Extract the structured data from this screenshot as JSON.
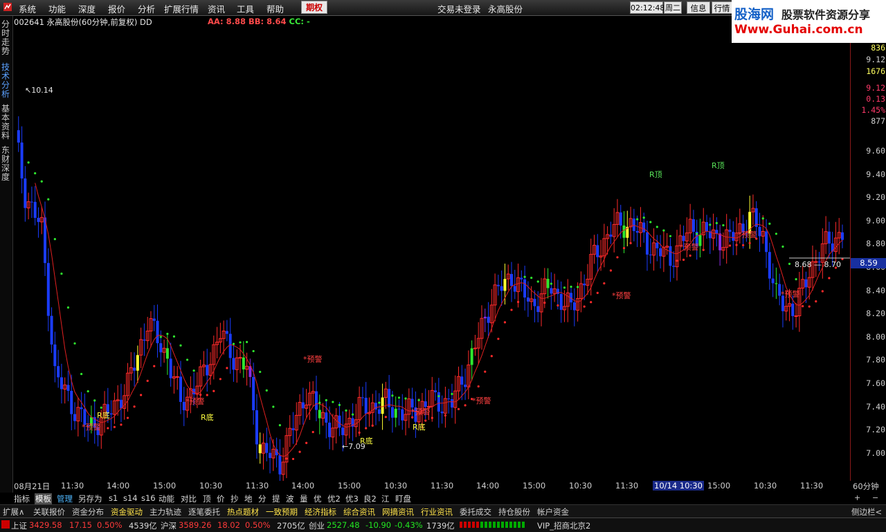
{
  "menu": {
    "items": [
      "系统",
      "功能",
      "深度",
      "报价",
      "分析",
      "扩展行情",
      "资讯",
      "工具",
      "帮助"
    ],
    "active_tab": "期权",
    "trade_status": "交易未登录",
    "stock_name_red": "永高股份",
    "clock": "02:12:48",
    "weekday": "周二",
    "btn_info": "信息",
    "btn_quote": "行情"
  },
  "logo": {
    "line1a": "股海网",
    "line1b": "股票软件资源分享",
    "line2": "Www.Guhai.com.cn"
  },
  "left_tabs": [
    "分时走势",
    "技术分析",
    "基本资料",
    "东财深度"
  ],
  "header": {
    "code_title": "002641 永高股份(60分钟,前复权) DD",
    "aa_label": "AA: 8.88",
    "bb_label": "BB: 8.64",
    "cc_label": "CC: -"
  },
  "right_axis": {
    "top_values": [
      "836",
      "9.12",
      "1676",
      "9.12",
      "0.13",
      "1.45%",
      "877"
    ],
    "price_ticks": [
      "9.60",
      "9.40",
      "9.20",
      "9.00",
      "8.80",
      "8.60",
      "8.40",
      "8.20",
      "8.00",
      "7.80",
      "7.60",
      "7.40",
      "7.20",
      "7.00"
    ],
    "current_price": "8.59",
    "period": "60分钟"
  },
  "time_axis": {
    "labels": [
      "08月21日",
      "11:30",
      "14:00",
      "15:00",
      "10:30",
      "11:30",
      "14:00",
      "15:00",
      "10:30",
      "11:30",
      "14:00",
      "15:00",
      "10:30",
      "11:30",
      "15:00",
      "10:30",
      "11:30"
    ],
    "highlight": "10/14 10:30"
  },
  "annotations": {
    "high_label": "10.14",
    "low_label": "7.09",
    "range_label": "8.68 — 8.70",
    "top_signal": "R顶",
    "bottom_signal": "R底",
    "warn_signal": "预警"
  },
  "toolbar_row": {
    "items": [
      "指标",
      "模板",
      "管理",
      "另存为",
      "s1",
      "s14",
      "s16",
      "动能",
      "对比",
      "顶",
      "价",
      "抄",
      "地",
      "分",
      "提",
      "波",
      "量",
      "优",
      "优2",
      "优3",
      "良2",
      "江",
      "盯盘"
    ],
    "selected": "模板",
    "highlighted": "管理",
    "right_plus": "+",
    "right_minus": "−"
  },
  "feature_row": {
    "items": [
      "扩展∧",
      "关联报价",
      "资金分布",
      "资金驱动",
      "主力轨迹",
      "逐笔委托",
      "热点题材",
      "一致预期",
      "经济指标",
      "综合资讯",
      "网摘资讯",
      "行业资讯",
      "委托成交",
      "持仓股份",
      "帐户资金"
    ],
    "yellow": [
      "资金驱动",
      "热点题材",
      "一致预期",
      "经济指标",
      "综合资讯",
      "网摘资讯",
      "行业资讯"
    ],
    "side": "侧边栏<"
  },
  "status": {
    "sh_name": "上证",
    "sh_price": "3429.58",
    "sh_chg": "17.15",
    "sh_pct": "0.50%",
    "sh_amt": "4539亿",
    "hs_name": "沪深",
    "hs_price": "3589.26",
    "hs_chg": "18.02",
    "hs_pct": "0.50%",
    "hs_amt": "2705亿",
    "cy_name": "创业",
    "cy_price": "2527.48",
    "cy_chg": "-10.90",
    "cy_pct": "-0.43%",
    "cy_amt": "1739亿",
    "server": "VIP_招商北京2"
  },
  "colors": {
    "up": "#ff2a2a",
    "down": "#1a3cff",
    "green": "#2ee82e",
    "yellow": "#ffff30",
    "purple": "#8a2be2",
    "ma": "#e02020"
  }
}
